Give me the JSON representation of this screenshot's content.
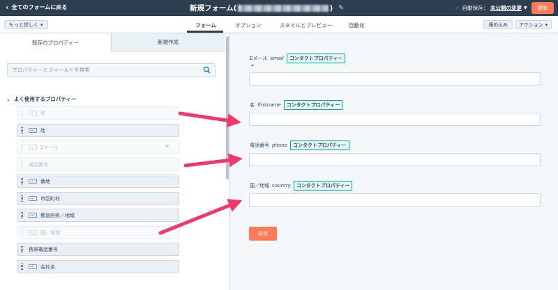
{
  "topbar": {
    "back_label": "全てのフォームに戻る",
    "title": "新規フォーム(",
    "title_close": ")",
    "autosave_prefix": "自動保存：",
    "autosave_link": "未公開の変更",
    "update_label": "更新"
  },
  "tabbar": {
    "more_label": "もっと詳しく",
    "tabs": [
      "フォーム",
      "オプション",
      "スタイルとプレビュー",
      "自動化"
    ],
    "embed_label": "埋め込み",
    "action_label": "アクション"
  },
  "left": {
    "tab_existing": "既存のプロパティー",
    "tab_new": "新規作成",
    "search_placeholder": "プロパティーとフィールドを検索",
    "section_title": "よく使用するプロパティー",
    "properties": [
      "名",
      "姓",
      "Eメール",
      "電話番号",
      "番地",
      "市区町村",
      "都道府県／地域",
      "国／地域",
      "携帯電話番号",
      "会社名"
    ]
  },
  "form": {
    "fields": [
      {
        "label": "Eメール",
        "internal": "email",
        "badge": "コンタクトプロパティー"
      },
      {
        "label": "名",
        "internal": "firstname",
        "badge": "コンタクトプロパティー"
      },
      {
        "label": "電話番号",
        "internal": "phone",
        "badge": "コンタクトプロパティー"
      },
      {
        "label": "国／地域",
        "internal": "country",
        "badge": "コンタクトプロパティー"
      }
    ],
    "required_mark": "*",
    "submit_label": "送信"
  },
  "colors": {
    "topbar": "#2d3e50",
    "accent": "#ff7a59",
    "badge_border": "#00a4bd",
    "arrow": "#f0386b"
  }
}
